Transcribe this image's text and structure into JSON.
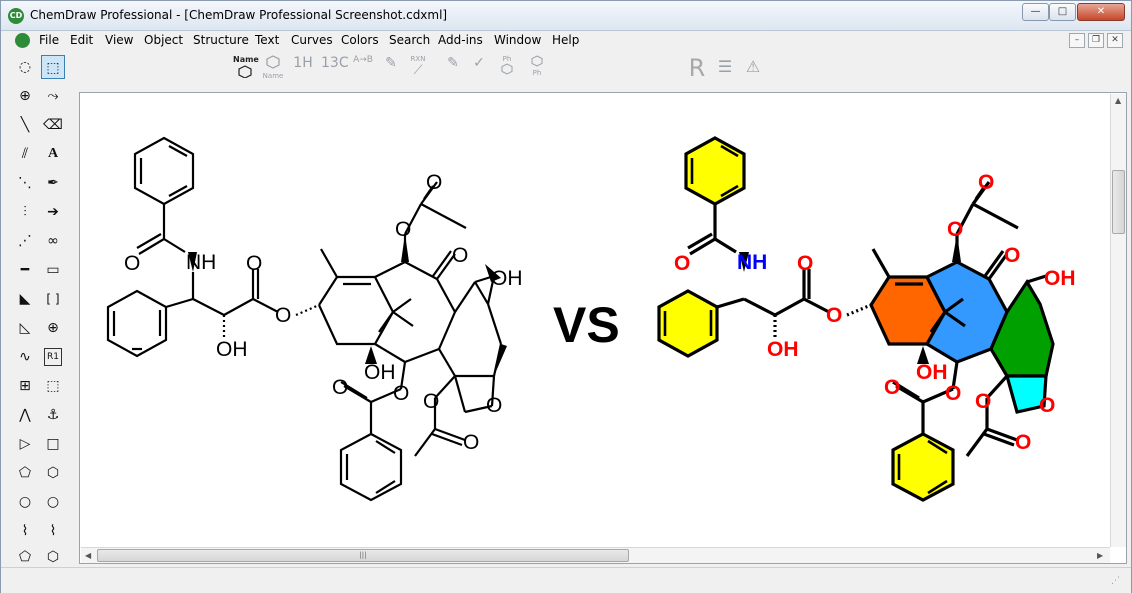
{
  "window": {
    "title": "ChemDraw Professional - [ChemDraw Professional Screenshot.cdxml]",
    "app_icon": "chemdraw-logo-icon",
    "controls": {
      "minimize": "—",
      "maximize": "□",
      "close": "✕"
    }
  },
  "menubar": {
    "items": [
      "File",
      "Edit",
      "View",
      "Object",
      "Structure",
      "Text",
      "Curves",
      "Colors",
      "Search",
      "Add-ins",
      "Window",
      "Help"
    ],
    "mdi_controls": {
      "minimize": "–",
      "restore": "❐",
      "close": "✕"
    }
  },
  "toolbar": {
    "name_label": "Name",
    "struct_label": "Name",
    "h_nmr": "1H",
    "c_nmr": "13C",
    "ab_label": "A→B",
    "rxn_label": "RXN",
    "ph_label": "Ph",
    "ph_label2": "Ph",
    "r_label": "R"
  },
  "palette": {
    "text_tool": "A",
    "bracket_tool": "[ ]",
    "r_group_label": "R1"
  },
  "document": {
    "vs_text": "VS",
    "labels": {
      "nh": "NH",
      "oh": "OH",
      "o": "O"
    },
    "colors": {
      "benzene_fill": "#ffff00",
      "ring_orange": "#ff6600",
      "ring_blue": "#3399ff",
      "ring_green": "#00a000",
      "ring_cyan": "#00ffff",
      "oxygen": "#ff0000",
      "nitrogen": "#0000ff",
      "bond": "#000000"
    }
  }
}
